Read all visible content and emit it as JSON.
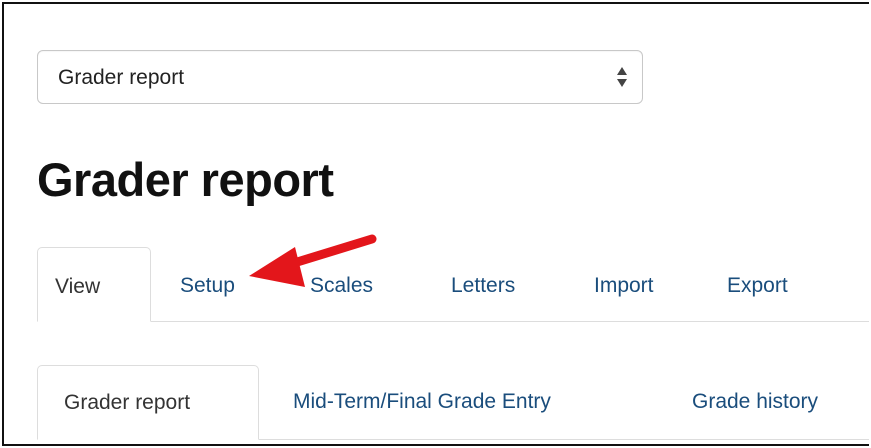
{
  "report_select": {
    "value": "Grader report"
  },
  "page_title": "Grader report",
  "main_tabs": [
    {
      "label": "View",
      "active": true
    },
    {
      "label": "Setup",
      "active": false
    },
    {
      "label": "Scales",
      "active": false
    },
    {
      "label": "Letters",
      "active": false
    },
    {
      "label": "Import",
      "active": false
    },
    {
      "label": "Export",
      "active": false
    }
  ],
  "sub_tabs": [
    {
      "label": "Grader report",
      "active": true
    },
    {
      "label": "Mid-Term/Final Grade Entry",
      "active": false
    },
    {
      "label": "Grade history",
      "active": false
    }
  ],
  "colors": {
    "link": "#1a4d7c",
    "annotation_arrow": "#e3161b"
  }
}
